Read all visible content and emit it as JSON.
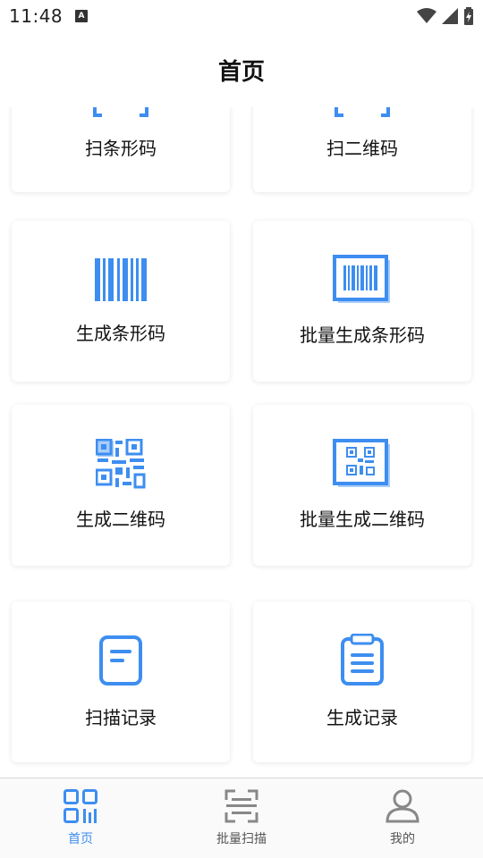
{
  "status": {
    "time": "11:48",
    "notification_glyph": "A"
  },
  "header": {
    "title": "首页"
  },
  "cards": {
    "scan_barcode": "扫条形码",
    "scan_qrcode": "扫二维码",
    "gen_barcode": "生成条形码",
    "batch_gen_barcode": "批量生成条形码",
    "gen_qrcode": "生成二维码",
    "batch_gen_qrcode": "批量生成二维码",
    "scan_history": "扫描记录",
    "gen_history": "生成记录"
  },
  "tabs": [
    {
      "label": "首页",
      "icon": "qr-home-icon",
      "active": true
    },
    {
      "label": "批量扫描",
      "icon": "batch-scan-icon",
      "active": false
    },
    {
      "label": "我的",
      "icon": "person-icon",
      "active": false
    }
  ],
  "colors": {
    "accent": "#3d8ef0",
    "accent_light": "#a9ccf8",
    "inactive_icon": "#888888"
  }
}
